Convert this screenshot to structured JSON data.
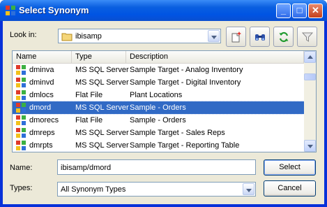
{
  "window": {
    "title": "Select Synonym"
  },
  "look_in": {
    "label": "Look in:",
    "value": "ibisamp"
  },
  "toolbar": {
    "icons": [
      "new-folder-icon",
      "find-icon",
      "refresh-icon",
      "filter-icon"
    ]
  },
  "list": {
    "columns": [
      "Name",
      "Type",
      "Description"
    ],
    "rows": [
      {
        "name": "dminva",
        "type": "MS SQL Server",
        "description": "Sample Target - Analog Inventory",
        "selected": false
      },
      {
        "name": "dminvd",
        "type": "MS SQL Server",
        "description": "Sample Target - Digital Inventory",
        "selected": false
      },
      {
        "name": "dmlocs",
        "type": "Flat File",
        "description": "Plant Locations",
        "selected": false
      },
      {
        "name": "dmord",
        "type": "MS SQL Server",
        "description": "Sample - Orders",
        "selected": true
      },
      {
        "name": "dmorecs",
        "type": "Flat File",
        "description": "Sample - Orders",
        "selected": false
      },
      {
        "name": "dmreps",
        "type": "MS SQL Server",
        "description": "Sample Target - Sales Reps",
        "selected": false
      },
      {
        "name": "dmrpts",
        "type": "MS SQL Server",
        "description": "Sample Target - Reporting Table",
        "selected": false
      }
    ]
  },
  "name_field": {
    "label": "Name:",
    "value": "ibisamp/dmord"
  },
  "types_field": {
    "label": "Types:",
    "value": "All Synonym Types"
  },
  "buttons": {
    "select": "Select",
    "cancel": "Cancel"
  },
  "colors": {
    "titlebar": "#0054e3",
    "selection": "#316ac5",
    "dialog_bg": "#ece9d8"
  }
}
